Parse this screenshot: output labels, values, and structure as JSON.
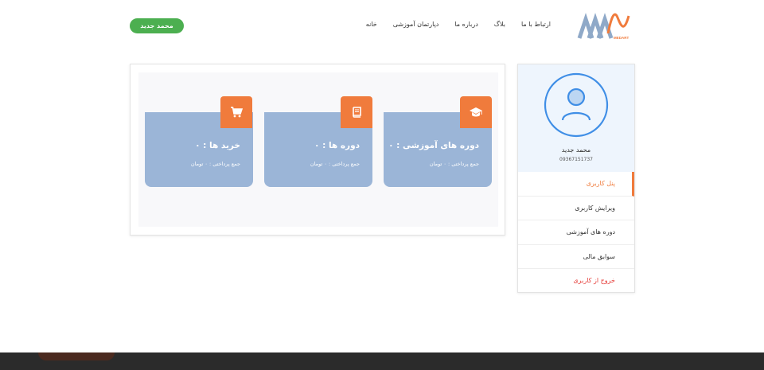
{
  "header": {
    "logo_text": "MEDART",
    "nav": [
      {
        "label": "خانه"
      },
      {
        "label": "دپارتمان آموزشی"
      },
      {
        "label": "درباره ما"
      },
      {
        "label": "بلاگ"
      },
      {
        "label": "ارتباط با ما"
      }
    ],
    "user_button": "محمد جدید"
  },
  "cards": [
    {
      "title": "دوره های آموزشی : ۰",
      "subtitle": "جمع پرداختی : ۰ تومان",
      "icon": "graduation-cap-icon"
    },
    {
      "title": "دوره ها : ۰",
      "subtitle": "جمع پرداختی : ۰ تومان",
      "icon": "book-icon"
    },
    {
      "title": "خرید ها : ۰",
      "subtitle": "جمع پرداختی : ۰ تومان",
      "icon": "shopping-cart-icon"
    }
  ],
  "sidebar": {
    "profile": {
      "name": "محمد جدید",
      "phone": "09367151737"
    },
    "menu": [
      {
        "label": "پنل کاربری"
      },
      {
        "label": "ویرایش کاربری"
      },
      {
        "label": "دوره های آموزشی"
      },
      {
        "label": "سوابق مالی"
      },
      {
        "label": "خروج از کاربری"
      }
    ]
  },
  "colors": {
    "accent": "#f07b3c",
    "card": "#9bb5d7",
    "success": "#4caf50",
    "danger": "#e53935",
    "avatar": "#3f8ee6"
  }
}
